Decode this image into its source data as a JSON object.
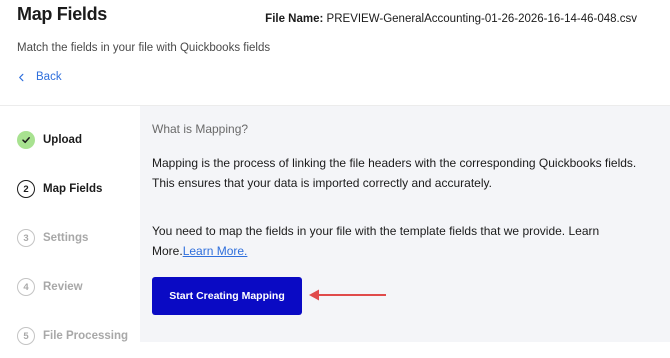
{
  "header": {
    "title": "Map Fields",
    "file_name_label": "File Name:",
    "file_name_value": "PREVIEW-GeneralAccounting-01-26-2026-16-14-46-048.csv",
    "subtitle": "Match the fields in your file with Quickbooks fields",
    "back_label": "Back"
  },
  "stepper": {
    "steps": [
      {
        "number": "1",
        "label": "Upload",
        "state": "done"
      },
      {
        "number": "2",
        "label": "Map Fields",
        "state": "active"
      },
      {
        "number": "3",
        "label": "Settings",
        "state": "pending"
      },
      {
        "number": "4",
        "label": "Review",
        "state": "pending"
      },
      {
        "number": "5",
        "label": "File Processing",
        "state": "pending"
      }
    ]
  },
  "main": {
    "heading": "What is Mapping?",
    "paragraph1": "Mapping is the process of linking the file headers with the corresponding Quickbooks fields. This ensures that your data is imported correctly and accurately.",
    "paragraph2": "You need to map the fields in your file with the template fields that we provide. Learn More.",
    "learn_more_label": "Learn More.",
    "cta_label": "Start Creating Mapping"
  },
  "colors": {
    "accent_button": "#0a0ac4",
    "link": "#2f6fdc",
    "done_step": "#a8e290",
    "annotation_arrow": "#e04b4b"
  },
  "icons": {
    "back": "chevron-left-icon",
    "done_step": "checkmark-icon",
    "annotation": "arrow-left-icon"
  }
}
